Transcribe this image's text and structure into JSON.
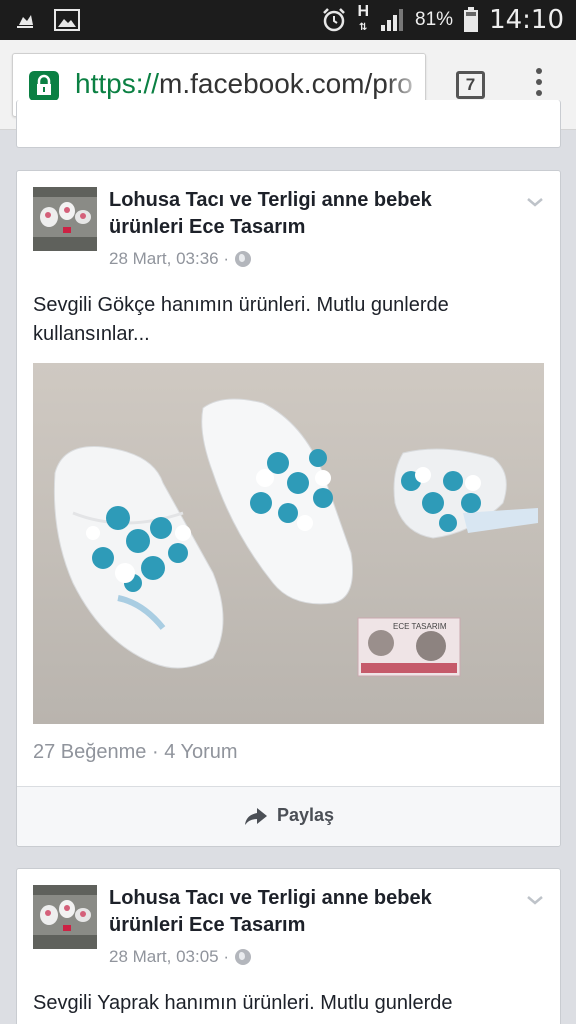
{
  "status_bar": {
    "battery_percent": "81%",
    "time": "14:10",
    "network": "H",
    "icons": [
      "notification-icon",
      "image-icon",
      "alarm-icon",
      "signal-icon",
      "battery-icon"
    ]
  },
  "browser": {
    "url_scheme": "https://",
    "url_rest": "m.facebook.com/pro",
    "tab_count": "7",
    "accent_color": "#0b8043"
  },
  "posts": [
    {
      "page_name": "Lohusa Tacı ve Terligi anne bebek ürünleri Ece Tasarım",
      "time": "28 Mart, 03:36 ·",
      "text": "Sevgili Gökçe hanımın ürünleri. Mutlu gunlerde kullansınlar...",
      "counts": "27 Beğenme · 4 Yorum",
      "share_label": "Paylaş"
    },
    {
      "page_name": "Lohusa Tacı ve Terligi anne bebek ürünleri Ece Tasarım",
      "time": "28 Mart, 03:05 ·",
      "text": "Sevgili Yaprak hanımın ürünleri. Mutlu gunlerde"
    }
  ]
}
